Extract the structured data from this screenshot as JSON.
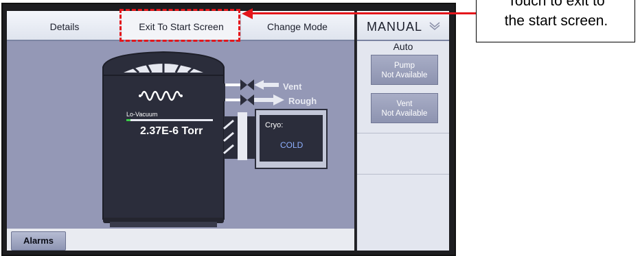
{
  "tabs": {
    "details": "Details",
    "exit_start": "Exit To Start Screen",
    "change_mode": "Change Mode"
  },
  "side": {
    "mode": "MANUAL",
    "auto": "Auto",
    "pump_line1": "Pump",
    "pump_line2": "Not Available",
    "vent_line1": "Vent",
    "vent_line2": "Not Available"
  },
  "schematic": {
    "vent_label": "Vent",
    "rough_label": "Rough",
    "gauge_label": "Lo-Vacuum",
    "pressure": "2.37E-6 Torr",
    "cryo_label": "Cryo:",
    "cryo_status": "COLD"
  },
  "bottom": {
    "alarms": "Alarms"
  },
  "callout": {
    "line1": "Touch to exit to",
    "line2": "the start screen."
  },
  "colors": {
    "highlight": "#e4161b",
    "cryo_status": "#8fb0ff",
    "background_panel": "#9498b6"
  }
}
